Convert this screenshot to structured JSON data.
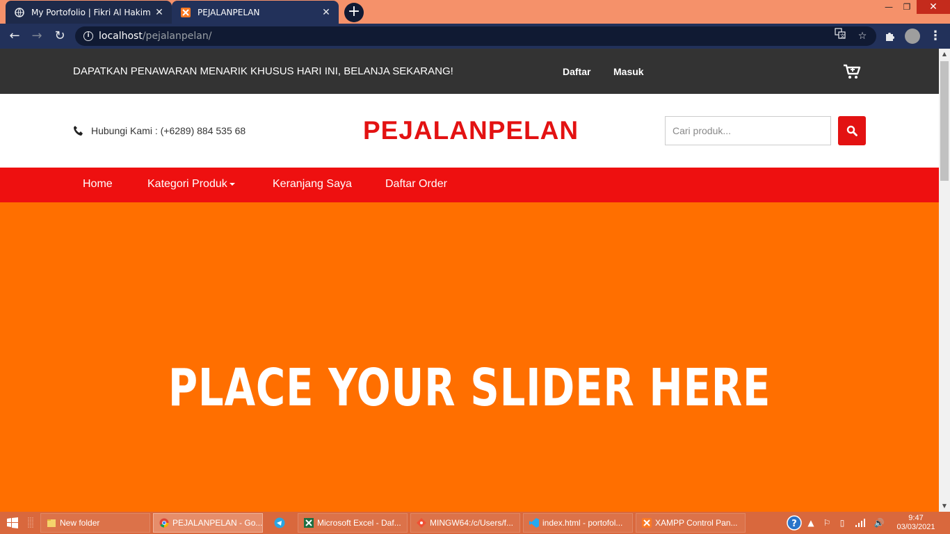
{
  "browser": {
    "tabs": [
      {
        "title": "My Portofolio | Fikri Al Hakim",
        "active": false
      },
      {
        "title": "PEJALANPELAN",
        "active": true
      }
    ],
    "url": {
      "host": "localhost",
      "path": "/pejalanpelan/"
    }
  },
  "site": {
    "promo": "DAPATKAN PENAWARAN MENARIK KHUSUS HARI INI, BELANJA SEKARANG!",
    "top_links": {
      "register": "Daftar",
      "login": "Masuk"
    },
    "contact": "Hubungi Kami : (+6289) 884 535 68",
    "brand": "PEJALANPELAN",
    "search_placeholder": "Cari produk...",
    "nav": {
      "home": "Home",
      "categories": "Kategori Produk",
      "cart": "Keranjang Saya",
      "orders": "Daftar Order"
    },
    "slider_text": "PLACE YOUR SLIDER HERE",
    "colors": {
      "topbar": "#333333",
      "brand": "#e31212",
      "nav": "#ee1010",
      "slider": "#ff6f00"
    }
  },
  "taskbar": {
    "items": [
      {
        "label": "New folder"
      },
      {
        "label": "PEJALANPELAN - Go..."
      },
      {
        "label": "Microsoft Excel - Daf..."
      },
      {
        "label": "MINGW64:/c/Users/f..."
      },
      {
        "label": "index.html - portofol..."
      },
      {
        "label": "XAMPP Control Pan..."
      }
    ],
    "time": "9:47",
    "date": "03/03/2021"
  }
}
